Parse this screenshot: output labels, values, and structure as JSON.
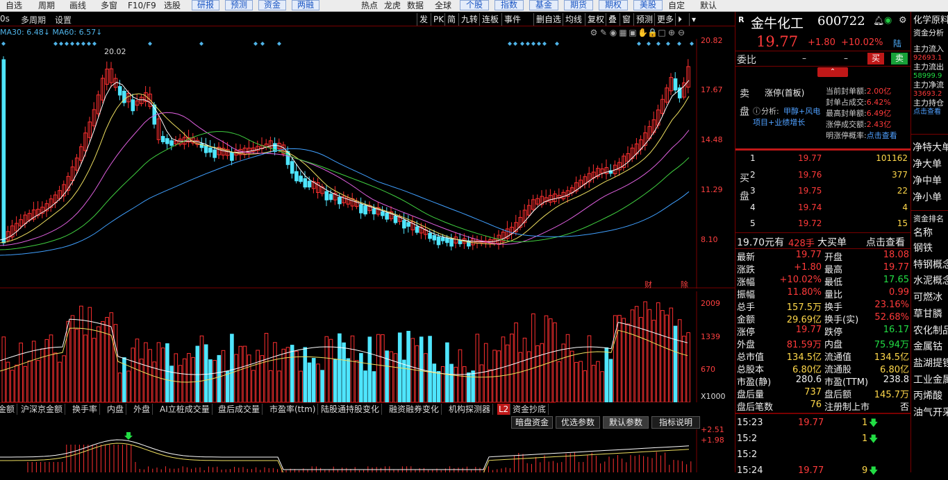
{
  "menubar": {
    "items": [
      "自选",
      "周期",
      "画线",
      "多窗",
      "F10/F9",
      "选股"
    ],
    "buttons": [
      "研报",
      "预测",
      "资金",
      "两融"
    ],
    "items2": [
      "热点",
      "龙虎",
      "数据",
      "全球"
    ],
    "buttons2": [
      "个股",
      "指数",
      "基金",
      "期货",
      "期权",
      "美股"
    ],
    "items3": [
      "自定",
      "默认"
    ]
  },
  "toolbar": {
    "left": [
      "0s",
      "多周期",
      "设置"
    ],
    "right": [
      "发",
      "PK",
      "简",
      "九转",
      "连板",
      "事件",
      "删自选",
      "均线",
      "复权",
      "叠",
      "窗",
      "预测",
      "更多"
    ]
  },
  "ma_legend": "MA30: 6.48↓ MA60: 6.57↓",
  "chart": {
    "high_label": "20.02",
    "y_labels": [
      "20.82",
      "17.67",
      "14.48",
      "11.29",
      "8.10"
    ],
    "vol_labels": [
      "2009",
      "1339",
      "670",
      "X1000"
    ],
    "ind_labels": [
      "+2.51",
      "+1.98"
    ],
    "tags": [
      "财",
      "除"
    ]
  },
  "ind_tabs": [
    "金额",
    "沪深京金额",
    "换手率",
    "内盘",
    "外盘",
    "AI立桩成交量",
    "盘后成交量",
    "市盈率(ttm)",
    "陆股通持股变化",
    "融资融券变化",
    "机构探测器",
    "L2",
    "资金抄底"
  ],
  "panel_buttons": [
    "暗盘资金",
    "优选参数",
    "默认参数",
    "指标说明"
  ],
  "stock": {
    "market": "R",
    "name": "金牛化工",
    "code": "600722",
    "price": "19.77",
    "change": "+1.80",
    "pct": "+10.02%",
    "tag": "陆"
  },
  "weibi": {
    "label": "委比",
    "v1": "–",
    "v2": "–",
    "buy": "买",
    "sell": "卖"
  },
  "limit": {
    "title": "涨停(首板)",
    "analysis_label": "分析:",
    "analysis": "甲醇+风电",
    "analysis2": "项目+业绩增长",
    "rows": [
      [
        "当前封单额:",
        "2.00亿"
      ],
      [
        "封单占成交:",
        "6.42%"
      ],
      [
        "最高封单额:",
        "6.49亿"
      ],
      [
        "涨停成交额:",
        "2.43亿"
      ],
      [
        "明涨停概率:",
        "点击查看"
      ]
    ]
  },
  "sell_side_label": "卖盘",
  "buy_side_label": "买盘",
  "bids": [
    [
      "1",
      "19.77",
      "101162"
    ],
    [
      "2",
      "19.76",
      "377"
    ],
    [
      "3",
      "19.75",
      "22"
    ],
    [
      "4",
      "19.74",
      "4"
    ],
    [
      "5",
      "19.72",
      "15"
    ]
  ],
  "big_order": {
    "price": "19.70元有",
    "qty": "428手",
    "label": "大买单",
    "link": "点击查看"
  },
  "quote": [
    [
      "最新",
      "19.77",
      "开盘",
      "18.08"
    ],
    [
      "涨跌",
      "+1.80",
      "最高",
      "19.77"
    ],
    [
      "涨幅",
      "+10.02%",
      "最低",
      "17.65"
    ],
    [
      "振幅",
      "11.80%",
      "量比",
      "0.99"
    ],
    [
      "总手",
      "157.5万",
      "换手",
      "23.16%"
    ],
    [
      "金额",
      "29.69亿",
      "换手(实)",
      "52.68%"
    ],
    [
      "涨停",
      "19.77",
      "跌停",
      "16.17"
    ],
    [
      "外盘",
      "81.59万",
      "内盘",
      "75.94万"
    ],
    [
      "总市值",
      "134.5亿",
      "流通值",
      "134.5亿"
    ],
    [
      "总股本",
      "6.80亿",
      "流通股",
      "6.80亿"
    ],
    [
      "市盈(静)",
      "280.6",
      "市盈(TTM)",
      "238.8"
    ],
    [
      "盘后量",
      "737",
      "盘后额",
      "145.7万"
    ],
    [
      "盘后笔数",
      "76",
      "注册制上市",
      "否"
    ]
  ],
  "ticks": [
    [
      "15:23",
      "19.77",
      "1"
    ],
    [
      "15:2",
      "",
      "1"
    ],
    [
      "15:2",
      "",
      ""
    ],
    [
      "15:24",
      "19.77",
      "9"
    ]
  ],
  "farright": {
    "title": "化学原料",
    "sub": "资金分析",
    "flows": [
      [
        "主力流入",
        "92693.1"
      ],
      [
        "主力流出",
        "58999.9"
      ],
      [
        "主力净流",
        "33693.2"
      ],
      [
        "主力持仓",
        "点击查看"
      ]
    ],
    "nets": [
      "净特大单",
      "净大单",
      "净中单",
      "净小单"
    ],
    "rank_label": "资金排名",
    "name_label": "名称",
    "names": [
      "钢铁",
      "特钢概念",
      "水泥概念",
      "可燃冰",
      "草甘膦",
      "农化制品",
      "金属钴",
      "盐湖提锂",
      "工业金属",
      "丙烯酸",
      "油气开采"
    ]
  }
}
